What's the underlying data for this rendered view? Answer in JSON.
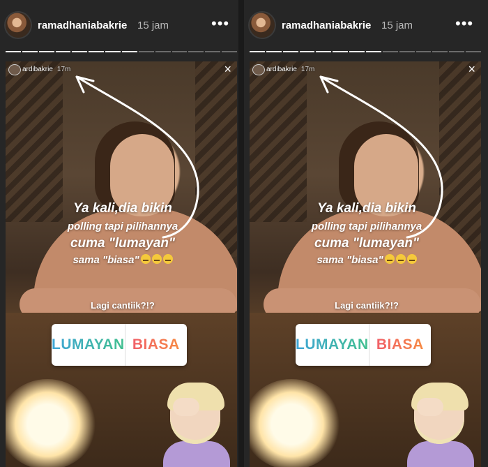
{
  "panels": [
    {
      "header": {
        "username": "ramadhaniabakrie",
        "time": "15 jam",
        "more": "•••"
      },
      "progress": {
        "segments": 14,
        "completed": 8
      },
      "story": {
        "reposted_user": "ardibakrie",
        "reposted_time": "17m",
        "close": "×",
        "caption": {
          "line1": "Ya kali,dia bikin",
          "line2": "polling tapi pilihannya",
          "line3": "cuma \"lumayan\"",
          "line4": "sama \"biasa\""
        },
        "poll": {
          "question": "Lagi cantiik?!?",
          "option_a": "LUMAYAN",
          "option_b": "BIASA"
        }
      }
    },
    {
      "header": {
        "username": "ramadhaniabakrie",
        "time": "15 jam",
        "more": "•••"
      },
      "progress": {
        "segments": 14,
        "completed": 8
      },
      "story": {
        "reposted_user": "ardibakrie",
        "reposted_time": "17m",
        "close": "×",
        "caption": {
          "line1": "Ya kali,dia bikin",
          "line2": "polling tapi pilihannya",
          "line3": "cuma \"lumayan\"",
          "line4": "sama \"biasa\""
        },
        "poll": {
          "question": "Lagi cantiik?!?",
          "option_a": "LUMAYAN",
          "option_b": "BIASA"
        }
      }
    }
  ],
  "colors": {
    "background": "#262626",
    "progress_done": "#f2f2f2",
    "progress_pending": "#6b6b6b",
    "poll_option_a": [
      "#3fa5d6",
      "#42c08f"
    ],
    "poll_option_b": [
      "#f05a6e",
      "#f7903d"
    ]
  },
  "icons": [
    "more-options-icon",
    "close-icon",
    "curved-arrow-icon",
    "expressionless-face-emoji"
  ]
}
